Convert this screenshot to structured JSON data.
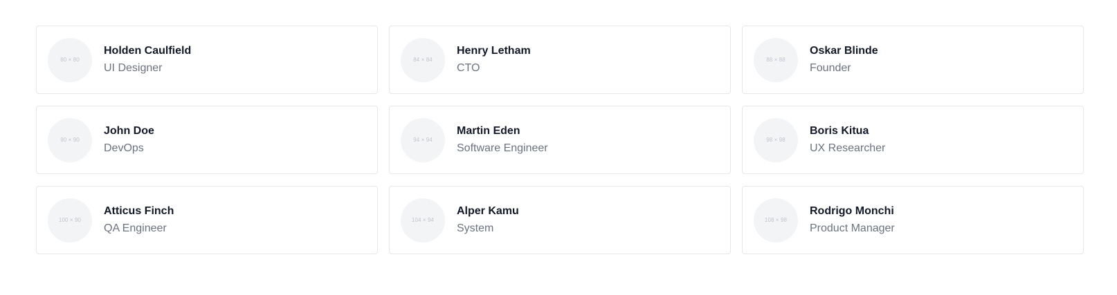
{
  "team": {
    "members": [
      {
        "avatar_placeholder": "80 × 80",
        "name": "Holden Caulfield",
        "role": "UI Designer"
      },
      {
        "avatar_placeholder": "84 × 84",
        "name": "Henry Letham",
        "role": "CTO"
      },
      {
        "avatar_placeholder": "88 × 88",
        "name": "Oskar Blinde",
        "role": "Founder"
      },
      {
        "avatar_placeholder": "90 × 90",
        "name": "John Doe",
        "role": "DevOps"
      },
      {
        "avatar_placeholder": "94 × 94",
        "name": "Martin Eden",
        "role": "Software Engineer"
      },
      {
        "avatar_placeholder": "98 × 98",
        "name": "Boris Kitua",
        "role": "UX Researcher"
      },
      {
        "avatar_placeholder": "100 × 90",
        "name": "Atticus Finch",
        "role": "QA Engineer"
      },
      {
        "avatar_placeholder": "104 × 94",
        "name": "Alper Kamu",
        "role": "System"
      },
      {
        "avatar_placeholder": "108 × 98",
        "name": "Rodrigo Monchi",
        "role": "Product Manager"
      }
    ]
  }
}
